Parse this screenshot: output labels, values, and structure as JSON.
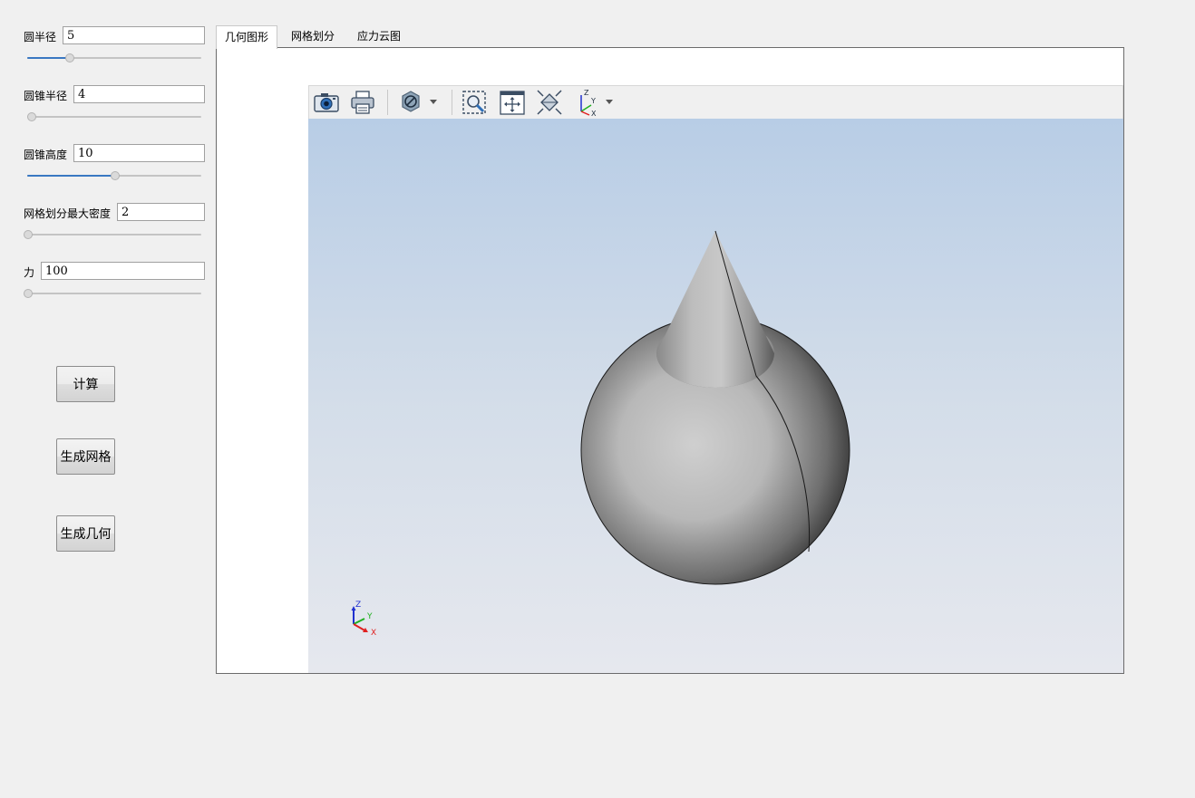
{
  "params": [
    {
      "label": "圆半径",
      "value": "5",
      "slider_fraction": 0.25
    },
    {
      "label": "圆锥半径",
      "value": "4",
      "slider_fraction": 0.0
    },
    {
      "label": "圆锥高度",
      "value": "10",
      "slider_fraction": 0.5
    },
    {
      "label": "网格划分最大密度",
      "value": "2",
      "slider_fraction": 0.0
    },
    {
      "label": "力",
      "value": "100",
      "slider_fraction": 0.0
    }
  ],
  "buttons": {
    "compute": "计算",
    "generate_mesh": "生成网格",
    "generate_geometry": "生成几何"
  },
  "tabs": [
    {
      "label": "几何图形",
      "active": true
    },
    {
      "label": "网格划分",
      "active": false
    },
    {
      "label": "应力云图",
      "active": false
    }
  ],
  "toolbar": {
    "icons": [
      "camera-icon",
      "print-icon",
      "visibility-icon",
      "zoom-box-icon",
      "pan-icon",
      "fit-all-icon",
      "axes-icon"
    ]
  },
  "triad": {
    "x": "X",
    "y": "Y",
    "z": "Z"
  },
  "colors": {
    "accent": "#3a78c2",
    "background_top": "#b8cde6",
    "background_bottom": "#e6e8ee",
    "axis_x": "#e02020",
    "axis_y": "#20b020",
    "axis_z": "#2030d0"
  }
}
